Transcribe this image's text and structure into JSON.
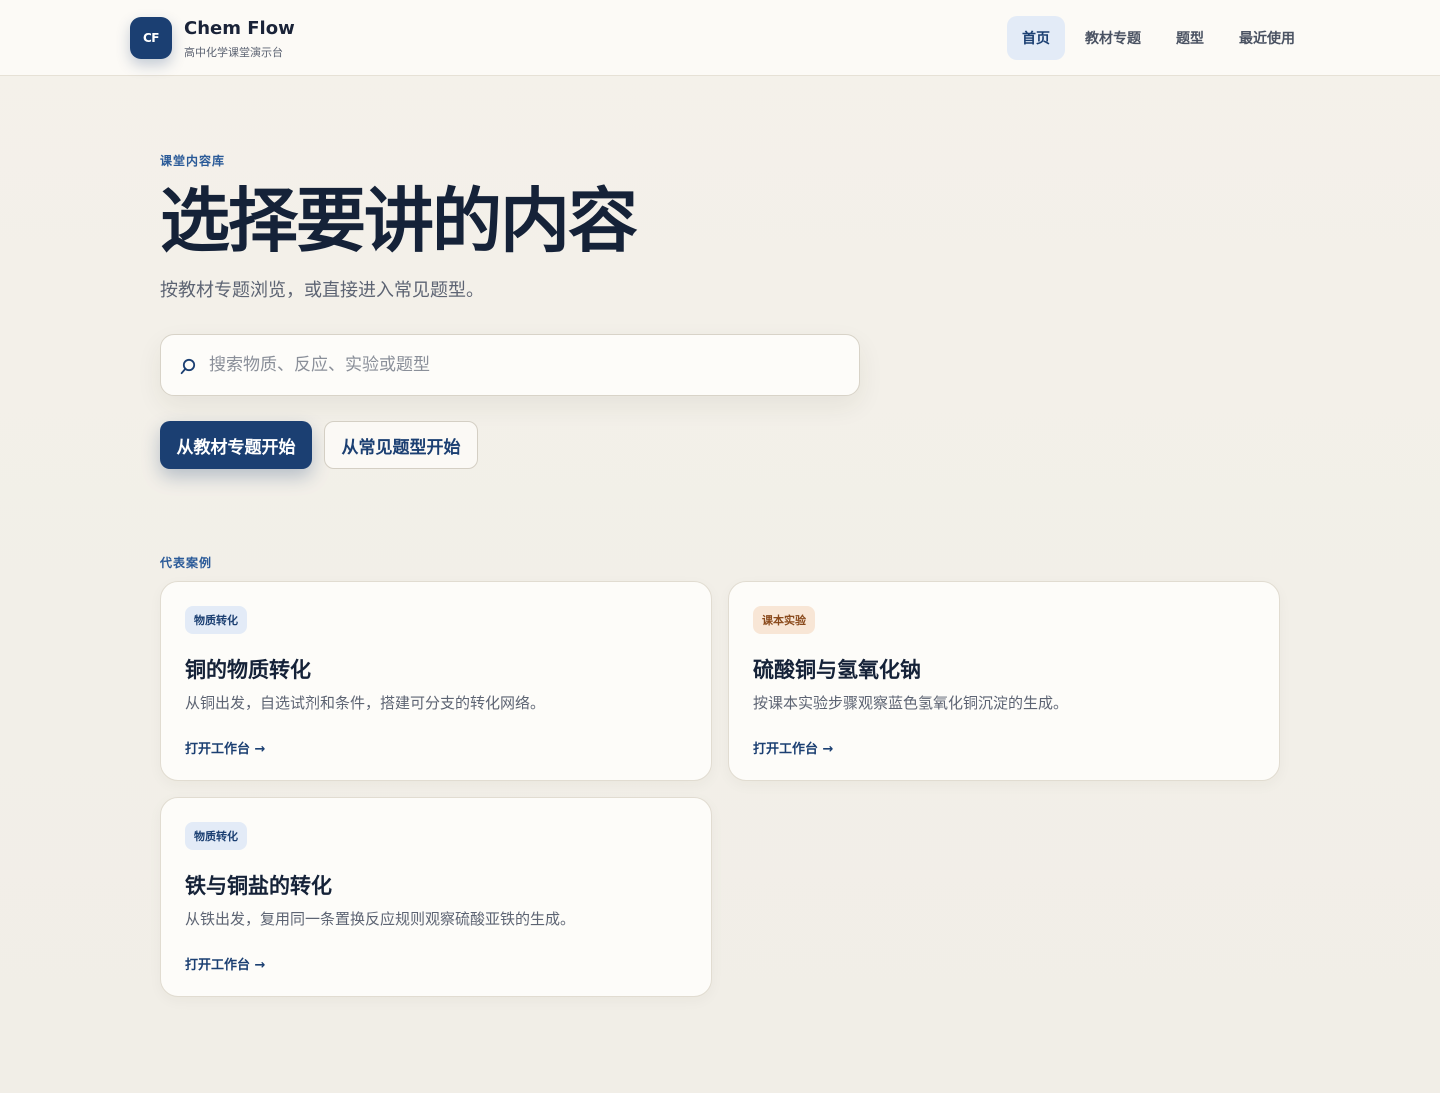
{
  "brand": {
    "badge": "CF",
    "name": "Chem Flow",
    "subtitle": "高中化学课堂演示台"
  },
  "nav": {
    "items": [
      {
        "label": "首页",
        "active": true
      },
      {
        "label": "教材专题",
        "active": false
      },
      {
        "label": "题型",
        "active": false
      },
      {
        "label": "最近使用",
        "active": false
      }
    ]
  },
  "hero": {
    "eyebrow": "课堂内容库",
    "title": "选择要讲的内容",
    "subtitle": "按教材专题浏览，或直接进入常见题型。"
  },
  "search": {
    "placeholder": "搜索物质、反应、实验或题型",
    "value": ""
  },
  "actions": {
    "primary_label": "从教材专题开始",
    "secondary_label": "从常见题型开始"
  },
  "cases": {
    "heading": "代表案例",
    "items": [
      {
        "tag": "物质转化",
        "title": "铜的物质转化",
        "desc": "从铜出发，自选试剂和条件，搭建可分支的转化网络。",
        "link": "打开工作台 →"
      },
      {
        "tag": "课本实验",
        "title": "硫酸铜与氢氧化钠",
        "desc": "按课本实验步骤观察蓝色氢氧化铜沉淀的生成。",
        "link": "打开工作台 →"
      },
      {
        "tag": "物质转化",
        "title": "铁与铜盐的转化",
        "desc": "从铁出发，复用同一条置换反应规则观察硫酸亚铁的生成。",
        "link": "打开工作台 →"
      }
    ]
  },
  "colors": {
    "accent": "#1b3f72",
    "tag_blue_bg": "#e3ebf7",
    "tag_peach_bg": "#f8e6d6",
    "page_bg": "#f3f0e9"
  },
  "icons": {
    "search": "search-icon"
  }
}
